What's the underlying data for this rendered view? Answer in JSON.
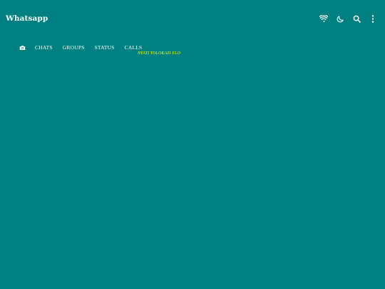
{
  "header": {
    "title": "Whatsapp"
  },
  "icons": {
    "wifi": "wifi-icon",
    "theme": "moon-icon",
    "search": "search-icon",
    "menu": "more-vertical-icon",
    "camera": "camera-icon"
  },
  "tabs": [
    {
      "label": "CHATS"
    },
    {
      "label": "GROUPS"
    },
    {
      "label": "STATUS"
    },
    {
      "label": "CALLS"
    }
  ],
  "banner": {
    "text": "NYATI TOLOKAZI ELO"
  },
  "colors": {
    "background": "#008080",
    "text": "#ffffff",
    "banner": "#ffff00"
  }
}
